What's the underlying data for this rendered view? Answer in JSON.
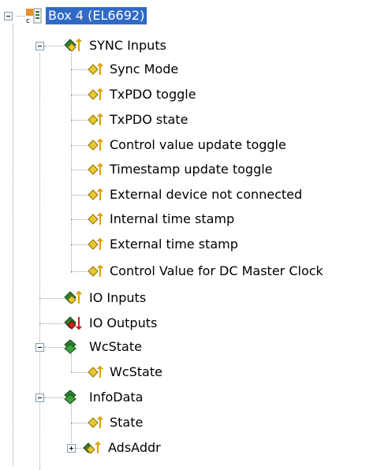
{
  "tree": {
    "root": {
      "label": "Box 4 (EL6692)",
      "icon": "ethercat-box-icon"
    },
    "sync_inputs": {
      "label": "SYNC Inputs",
      "icon": "input-group-icon",
      "children": [
        "Sync Mode",
        "TxPDO toggle",
        "TxPDO state",
        "Control value update toggle",
        "Timestamp update toggle",
        "External device not connected",
        "Internal time stamp",
        "External time stamp",
        "Control Value for DC Master Clock"
      ]
    },
    "io_inputs": {
      "label": "IO Inputs",
      "icon": "input-group-icon"
    },
    "io_outputs": {
      "label": "IO Outputs",
      "icon": "output-group-icon"
    },
    "wcstate": {
      "label": "WcState",
      "icon": "status-group-icon",
      "child": "WcState"
    },
    "infodata": {
      "label": "InfoData",
      "icon": "status-group-icon",
      "children": [
        "State",
        "AdsAddr"
      ]
    }
  }
}
